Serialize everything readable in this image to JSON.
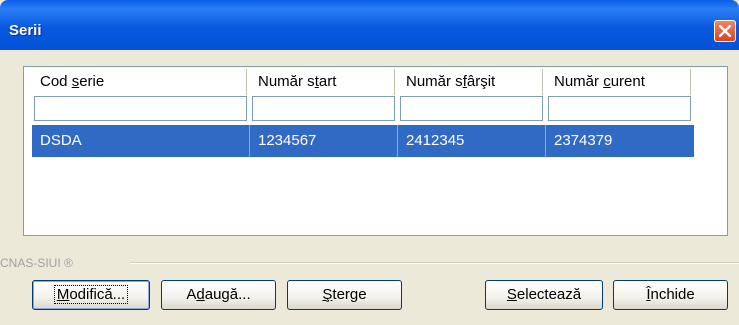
{
  "window": {
    "title": "Serii"
  },
  "columns": [
    {
      "pre": "Cod ",
      "key": "s",
      "post": "erie"
    },
    {
      "pre": "Număr s",
      "key": "t",
      "post": "art"
    },
    {
      "pre": "Număr s",
      "key": "f",
      "post": "ârşit"
    },
    {
      "pre": "Număr ",
      "key": "c",
      "post": "urent"
    }
  ],
  "rows": [
    {
      "cod_serie": "DSDA",
      "numar_start": "1234567",
      "numar_sfarsit": "2412345",
      "numar_curent": "2374379"
    }
  ],
  "group_label": "CNAS-SIUI ®",
  "buttons": {
    "modifica": {
      "key": "M",
      "post": "odifică..."
    },
    "adauga": {
      "pre": "A",
      "key": "d",
      "post": "augă..."
    },
    "sterge": {
      "key": "Ş",
      "post": "terge"
    },
    "selecteaza": {
      "key": "S",
      "post": "electează"
    },
    "inchide": {
      "key": "Î",
      "post": "nchide"
    }
  },
  "colors": {
    "title_bar": "#0a5fe6",
    "selection": "#316ac5",
    "close": "#d8431d"
  }
}
